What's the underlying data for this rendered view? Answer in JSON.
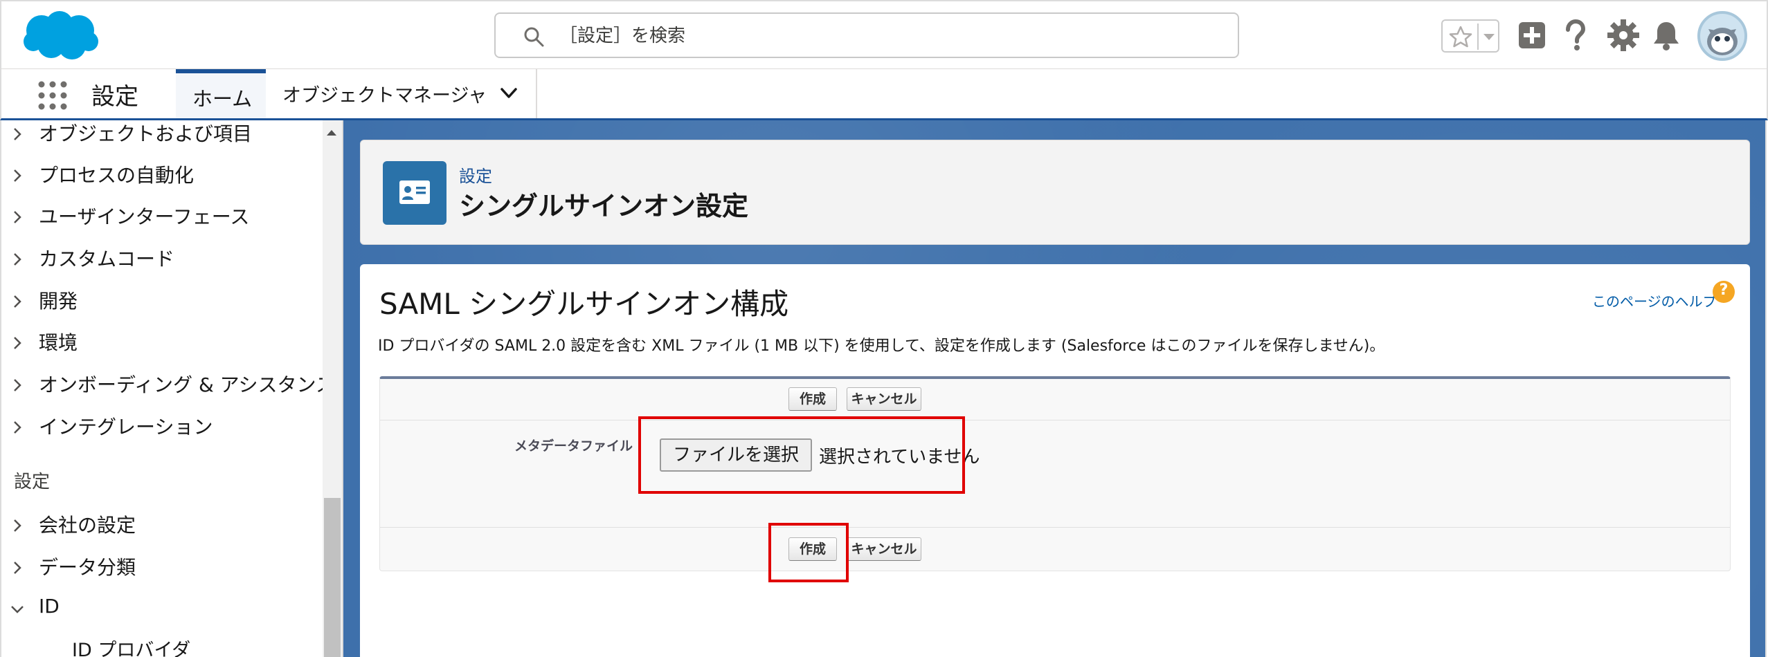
{
  "search": {
    "placeholder": "［設定］を検索"
  },
  "context_bar": {
    "app_name": "設定",
    "tabs": [
      {
        "label": "ホーム"
      },
      {
        "label": "オブジェクトマネージャ"
      }
    ]
  },
  "sidebar": {
    "items_top": [
      {
        "label": "オブジェクトおよび項目"
      },
      {
        "label": "プロセスの自動化"
      },
      {
        "label": "ユーザインターフェース"
      },
      {
        "label": "カスタムコード"
      },
      {
        "label": "開発"
      },
      {
        "label": "環境"
      },
      {
        "label": "オンボーディング & アシスタンス"
      },
      {
        "label": "インテグレーション"
      }
    ],
    "section_label": "設定",
    "items_settings": [
      {
        "label": "会社の設定"
      },
      {
        "label": "データ分類"
      },
      {
        "label": "ID"
      }
    ],
    "sub_item": "ID プロバイダ"
  },
  "page_header": {
    "breadcrumb": "設定",
    "title": "シングルサインオン設定"
  },
  "content": {
    "section_title": "SAML シングルサインオン構成",
    "help_link": "このページのヘルプ",
    "help_icon_glyph": "?",
    "description": "ID プロバイダの SAML 2.0 設定を含む XML ファイル (1 MB 以下) を使用して、設定を作成します (Salesforce はこのファイルを保存しません)。",
    "buttons": {
      "create": "作成",
      "cancel": "キャンセル"
    },
    "metadata_label": "メタデータファイル",
    "file_button": "ファイルを選択",
    "file_status": "選択されていません"
  },
  "colors": {
    "brand_blue": "#1b5297",
    "highlight_red": "#e00000",
    "header_icon_bg": "#2a72a9"
  }
}
